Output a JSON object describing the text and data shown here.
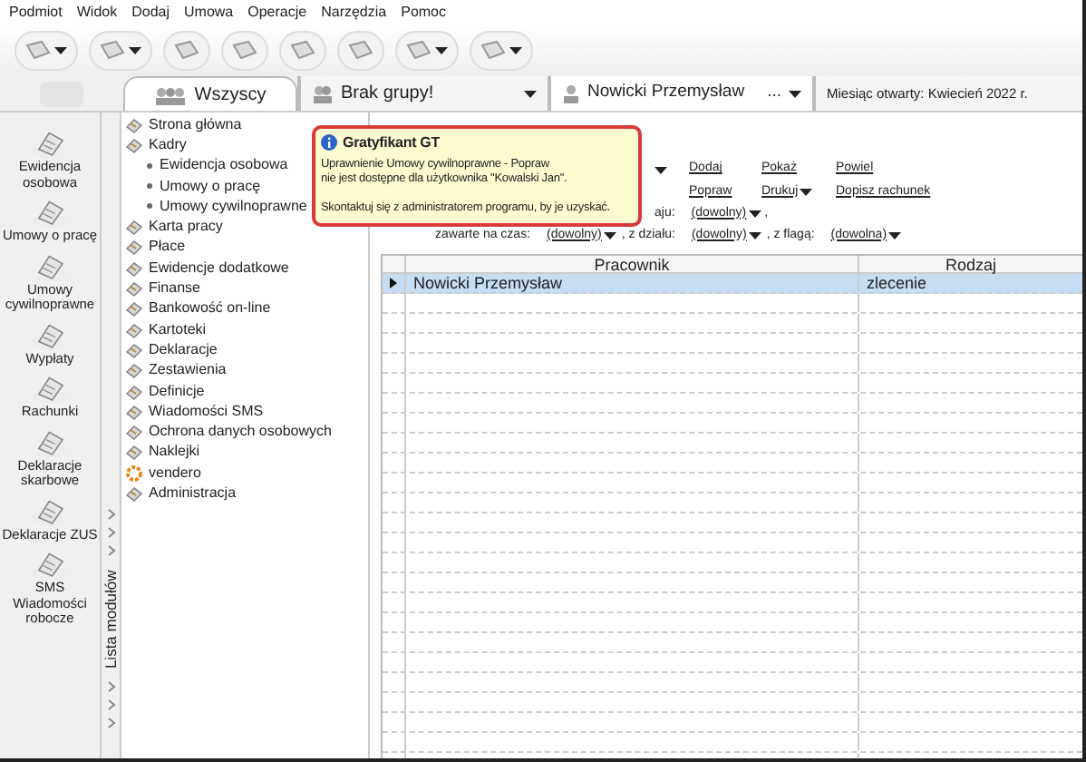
{
  "menu": [
    "Podmiot",
    "Widok",
    "Dodaj",
    "Umowa",
    "Operacje",
    "Narzędzia",
    "Pomoc"
  ],
  "toolbar": [
    {
      "dropdown": true
    },
    {
      "dropdown": true
    },
    {
      "dropdown": false
    },
    {
      "dropdown": false
    },
    {
      "dropdown": false
    },
    {
      "dropdown": false
    },
    {
      "dropdown": true
    },
    {
      "dropdown": true
    }
  ],
  "tabs": [
    {
      "label": "Wszyscy",
      "selected": true
    }
  ],
  "group_selector": {
    "value": "Brak grupy!"
  },
  "employee_selector": {
    "value": "Nowicki Przemysław",
    "more": "..."
  },
  "open_month": "Miesiąc otwarty: Kwiecień 2022 r.",
  "left_nav": [
    {
      "label": "Ewidencja osobowa"
    },
    {
      "label": "Umowy o pracę"
    },
    {
      "label": "Umowy cywilnoprawne"
    },
    {
      "label": "Wypłaty"
    },
    {
      "label": "Rachunki"
    },
    {
      "label": "Deklaracje skarbowe"
    },
    {
      "label": "Deklaracje ZUS"
    },
    {
      "label": "SMS Wiadomości robocze"
    }
  ],
  "modules_strip_label": "Lista modułów",
  "module_tree": [
    {
      "label": "Strona główna"
    },
    {
      "label": "Kadry",
      "children": [
        {
          "label": "Ewidencja osobowa"
        },
        {
          "label": "Umowy o pracę"
        },
        {
          "label": "Umowy cywilnoprawne"
        }
      ]
    },
    {
      "label": "Karta pracy"
    },
    {
      "label": "Płace"
    },
    {
      "label": "Ewidencje dodatkowe"
    },
    {
      "label": "Finanse"
    },
    {
      "label": "Bankowość on-line"
    },
    {
      "label": "Kartoteki"
    },
    {
      "label": "Deklaracje"
    },
    {
      "label": "Zestawienia"
    },
    {
      "label": "Definicje"
    },
    {
      "label": "Wiadomości SMS"
    },
    {
      "label": "Ochrona danych osobowych"
    },
    {
      "label": "Naklejki"
    },
    {
      "label": "vendero",
      "kind": "vendero"
    },
    {
      "label": "Administracja"
    }
  ],
  "tooltip": {
    "title": "Gratyfikant GT",
    "lines": [
      "Uprawnienie Umowy cywilnoprawne - Popraw",
      "nie jest dostępne dla użytkownika \"Kowalski Jan\".",
      "Skontaktuj się z administratorem programu, by je uzyskać."
    ]
  },
  "actions": [
    {
      "label": "Dodaj",
      "dropdown": false
    },
    {
      "label": "Pokaż",
      "dropdown": false
    },
    {
      "label": "Powiel",
      "dropdown": false
    },
    {
      "label": "Popraw",
      "dropdown": false
    },
    {
      "label": "Drukuj",
      "dropdown": true
    },
    {
      "label": "Dopisz rachunek",
      "dropdown": false
    }
  ],
  "filters": [
    [
      {
        "label": "aju:"
      },
      {
        "value": "(dowolny)",
        "trail": ","
      }
    ],
    [
      {
        "label": "zawarte na czas:"
      },
      {
        "value": "(dowolny)"
      },
      {
        "label": ", z działu:"
      },
      {
        "value": "(dowolny)"
      },
      {
        "label": ", z flagą:"
      },
      {
        "value": "(dowolna)"
      }
    ]
  ],
  "table": {
    "columns": [
      "Pracownik",
      "Rodzaj"
    ],
    "rows": [
      {
        "cells": [
          "Nowicki Przemysław",
          "zlecenie"
        ],
        "selected": true
      }
    ]
  }
}
